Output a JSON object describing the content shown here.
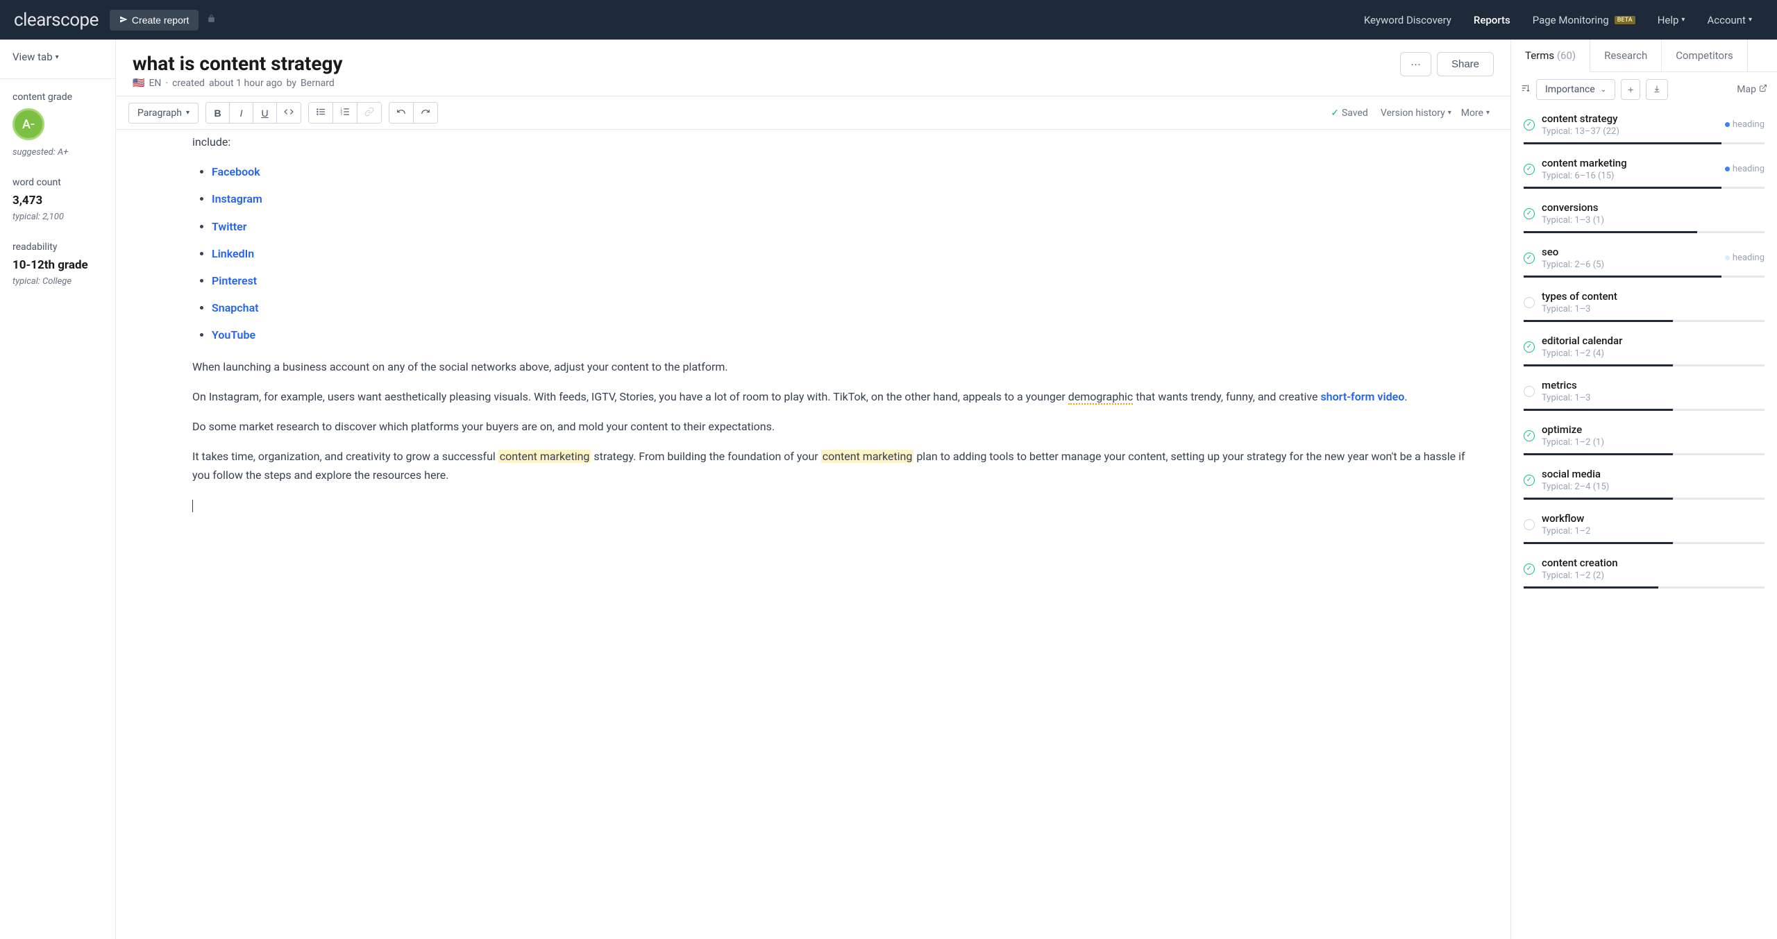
{
  "nav": {
    "logo": "clearscope",
    "create_report": "Create report",
    "links": {
      "keyword_discovery": "Keyword Discovery",
      "reports": "Reports",
      "page_monitoring": "Page Monitoring",
      "beta": "BETA",
      "help": "Help",
      "account": "Account"
    }
  },
  "sidebar": {
    "view_tab": "View tab",
    "content_grade_label": "content grade",
    "grade": "A-",
    "suggested": "suggested: A+",
    "word_count_label": "word count",
    "word_count": "3,473",
    "word_typical": "typical: 2,100",
    "readability_label": "readability",
    "readability": "10-12th grade",
    "readability_typical": "typical: College"
  },
  "doc": {
    "title": "what is content strategy",
    "lang": "EN",
    "created_prefix": "created",
    "created_time": "about 1 hour ago",
    "created_by_prefix": "by",
    "author": "Bernard",
    "share": "Share",
    "more_dots": "···"
  },
  "toolbar": {
    "paragraph": "Paragraph",
    "saved": "Saved",
    "version_history": "Version history",
    "more": "More"
  },
  "editor": {
    "include_trail": "include:",
    "items": {
      "facebook": "Facebook",
      "instagram": "Instagram",
      "twitter": "Twitter",
      "linkedin": "LinkedIn",
      "pinterest": "Pinterest",
      "snapchat": "Snapchat",
      "youtube": "YouTube"
    },
    "p1": "When launching a business account on any of the social networks above, adjust your content to the platform.",
    "p2a": "On Instagram, for example, users want aesthetically pleasing visuals. With feeds, IGTV, Stories, you have a lot of room to play with. TikTok, on the other hand, appeals to a younger ",
    "p2_demo": "demographic",
    "p2b": " that wants trendy, funny, and creative ",
    "p2_link": "short-form video",
    "p2c": ".",
    "p3": "Do some market research to discover which platforms your buyers are on, and mold your content to their expectations.",
    "p4a": "It takes time, organization, and creativity to grow a successful ",
    "p4_hl1": "content marketing",
    "p4b": " strategy. From building the foundation of your ",
    "p4_hl2": "content marketing",
    "p4c": " plan to adding tools to better manage your content, setting up your strategy for the new year won't be a hassle if you follow the steps and explore the resources here."
  },
  "right": {
    "tabs": {
      "terms": "Terms",
      "terms_count": "(60)",
      "research": "Research",
      "competitors": "Competitors"
    },
    "importance": "Importance",
    "map": "Map",
    "heading_label": "heading",
    "typical_label": "Typical:",
    "terms": [
      {
        "name": "content strategy",
        "range": "13–37",
        "count": "(22)",
        "status": "check",
        "badge": "blue",
        "fill": 82
      },
      {
        "name": "content marketing",
        "range": "6–16",
        "count": "(15)",
        "status": "check",
        "badge": "blue",
        "fill": 82
      },
      {
        "name": "conversions",
        "range": "1–3",
        "count": "(1)",
        "status": "check",
        "badge": "",
        "fill": 72
      },
      {
        "name": "seo",
        "range": "2–6",
        "count": "(5)",
        "status": "check",
        "badge": "light",
        "fill": 82
      },
      {
        "name": "types of content",
        "range": "1–3",
        "count": "",
        "status": "empty",
        "badge": "",
        "fill": 62
      },
      {
        "name": "editorial calendar",
        "range": "1–2",
        "count": "(4)",
        "status": "check",
        "badge": "",
        "fill": 62
      },
      {
        "name": "metrics",
        "range": "1–3",
        "count": "",
        "status": "empty",
        "badge": "",
        "fill": 62
      },
      {
        "name": "optimize",
        "range": "1–2",
        "count": "(1)",
        "status": "check",
        "badge": "",
        "fill": 62
      },
      {
        "name": "social media",
        "range": "2–4",
        "count": "(15)",
        "status": "check",
        "badge": "",
        "fill": 62
      },
      {
        "name": "workflow",
        "range": "1–2",
        "count": "",
        "status": "empty",
        "badge": "",
        "fill": 62
      },
      {
        "name": "content creation",
        "range": "1–2",
        "count": "(2)",
        "status": "check",
        "badge": "",
        "fill": 56
      }
    ]
  }
}
